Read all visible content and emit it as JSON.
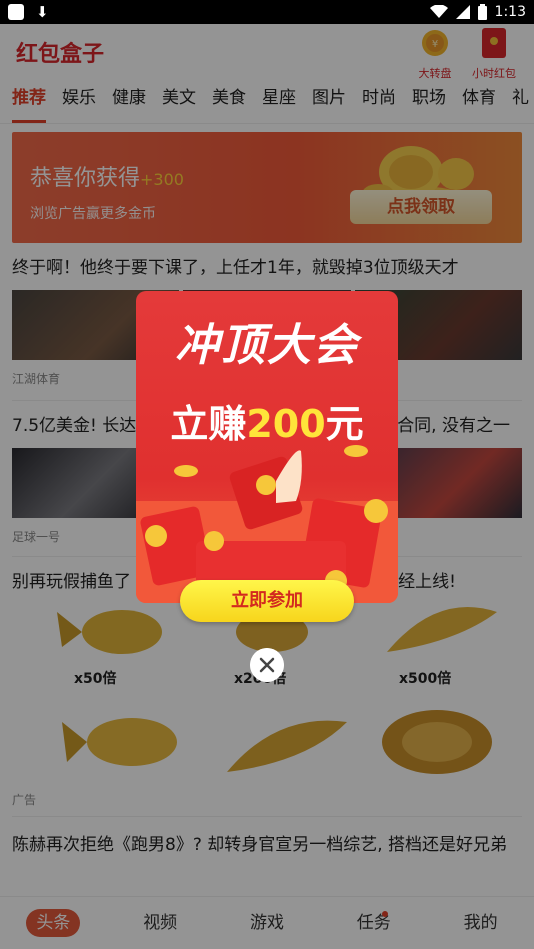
{
  "status_bar": {
    "time": "1:13"
  },
  "header": {
    "title": "红包盒子",
    "spin_label": "大转盘",
    "hourly_label": "小时红包"
  },
  "tabs": [
    "推荐",
    "娱乐",
    "健康",
    "美文",
    "美食",
    "星座",
    "图片",
    "时尚",
    "职场",
    "体育",
    "礼"
  ],
  "banner": {
    "title": "恭喜你获得",
    "bonus": "+300",
    "subtitle": "浏览广告赢更多金币",
    "cta": "点我领取"
  },
  "articles": [
    {
      "title": "终于啊！他终于要下课了，上任才1年，就毁掉3位顶级天才",
      "source": "江湖体育"
    },
    {
      "title_left": "7.5亿美金! 长达",
      "title_right": "合同, 没有之一",
      "source": "足球一号"
    },
    {
      "title_left": "别再玩假捕鱼了",
      "title_right": "经上线!",
      "source": "广告"
    },
    {
      "title": "陈赫再次拒绝《跑男8》? 却转身官宣另一档综艺, 搭档还是好兄弟"
    }
  ],
  "fish_multipliers": [
    "x50倍",
    "x200倍",
    "x500倍"
  ],
  "popup": {
    "headline": "冲顶大会",
    "earn_prefix": "立赚",
    "earn_amount": "200",
    "earn_suffix": "元",
    "button": "立即参加"
  },
  "bottom_nav": [
    "头条",
    "视频",
    "游戏",
    "任务",
    "我的"
  ],
  "colors": {
    "brand": "#d7262b",
    "accent": "#e0402a",
    "gold": "#ffd23c"
  }
}
